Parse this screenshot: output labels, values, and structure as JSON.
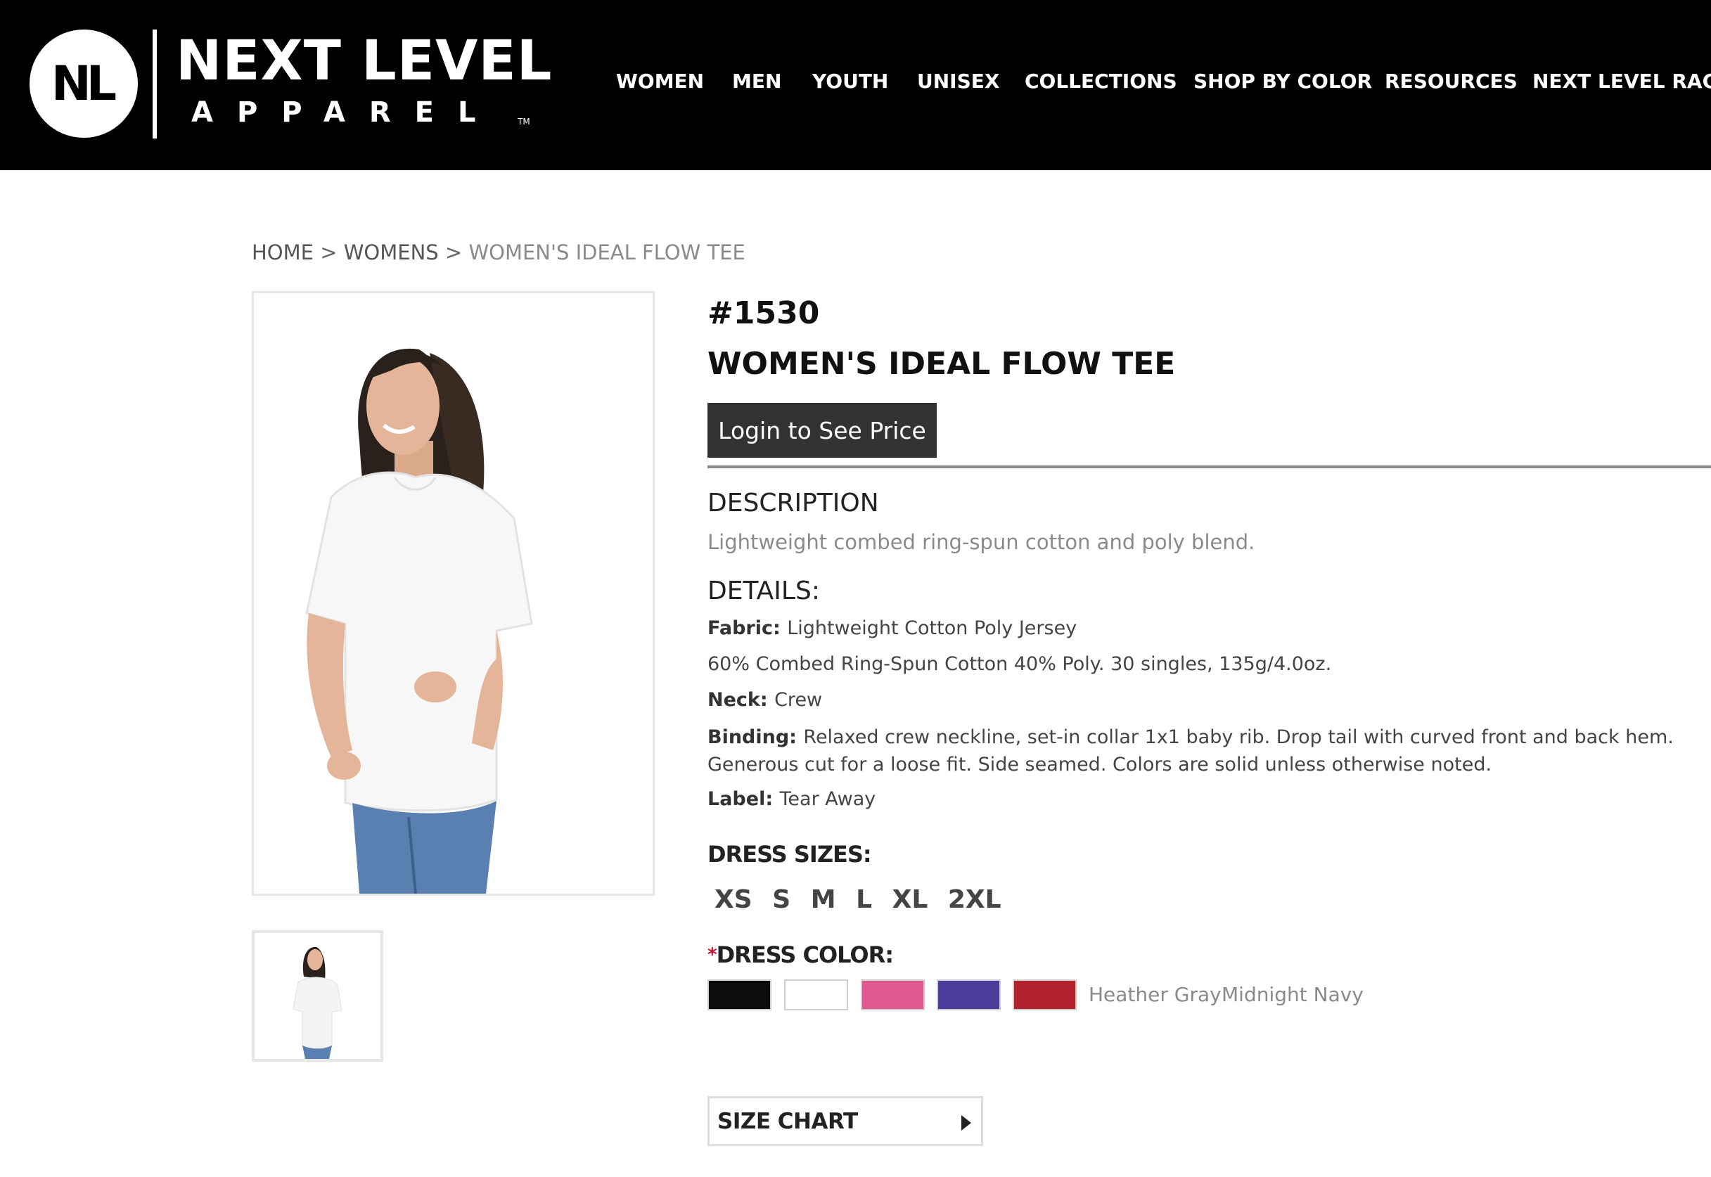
{
  "header": {
    "logo": {
      "mark": "NL",
      "word1": "NEXT LEVEL",
      "word2": "APPAREL",
      "tm": "TM"
    },
    "nav": [
      {
        "label": "WOMEN"
      },
      {
        "label": "MEN"
      },
      {
        "label": "YOUTH"
      },
      {
        "label": "UNISEX"
      },
      {
        "label": "COLLECTIONS"
      },
      {
        "label": "SHOP BY COLOR"
      },
      {
        "label": "RESOURCES"
      },
      {
        "label": "NEXT LEVEL RACK"
      }
    ]
  },
  "breadcrumb": {
    "items": [
      "HOME",
      "WOMENS",
      "WOMEN'S IDEAL FLOW TEE"
    ],
    "separator": ">"
  },
  "product": {
    "sku": "#1530",
    "title": "WOMEN'S IDEAL FLOW TEE",
    "login_button": "Login to See Price",
    "description_heading": "DESCRIPTION",
    "description": "Lightweight combed ring-spun cotton and poly blend.",
    "details_heading": "DETAILS:",
    "details": {
      "fabric_label": "Fabric:",
      "fabric_value": "Lightweight Cotton Poly Jersey",
      "composition": "60% Combed Ring-Spun Cotton 40% Poly. 30 singles, 135g/4.0oz.",
      "neck_label": "Neck:",
      "neck_value": "Crew",
      "binding_label": "Binding:",
      "binding_value": "Relaxed crew neckline, set-in collar 1x1 baby rib. Drop tail with curved front and back hem. Generous cut for a loose fit. Side seamed. Colors are solid unless otherwise noted.",
      "label_label": "Label:",
      "label_value": "Tear Away"
    },
    "sizes_heading": "DRESS SIZES:",
    "sizes": [
      "XS",
      "S",
      "M",
      "L",
      "XL",
      "2XL"
    ],
    "color_required_mark": "*",
    "color_heading": "DRESS COLOR:",
    "color_swatches": [
      {
        "name": "black",
        "hex": "#0d0b0e"
      },
      {
        "name": "white",
        "hex": "#ffffff"
      },
      {
        "name": "pink",
        "hex": "#e05a8f"
      },
      {
        "name": "purple",
        "hex": "#4a3d9a"
      },
      {
        "name": "red",
        "hex": "#b3222f"
      }
    ],
    "color_text_options": [
      "Heather Gray",
      "Midnight Navy"
    ],
    "size_chart_label": "SIZE CHART"
  },
  "colors": {
    "header_bg": "#000000",
    "button_bg": "#333333",
    "muted_text": "#8a8a8a"
  }
}
